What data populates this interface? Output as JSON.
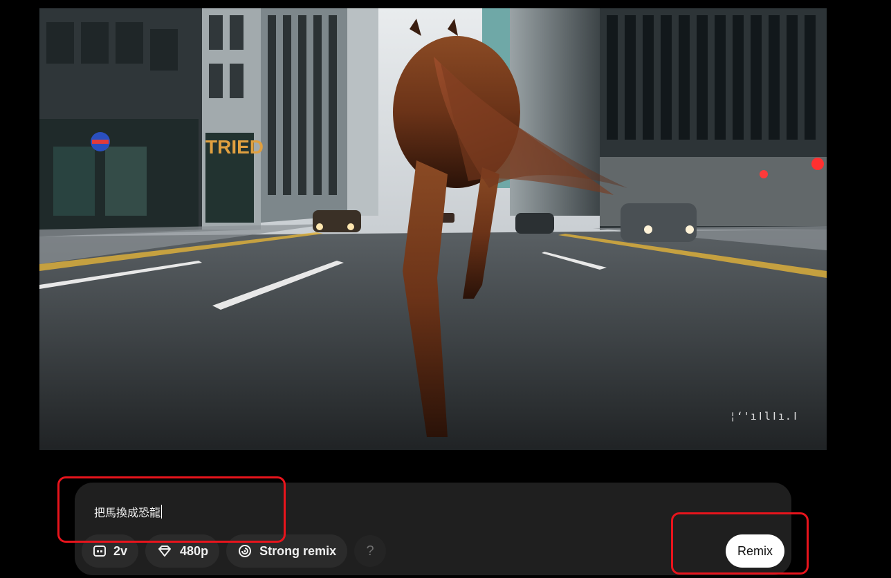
{
  "video": {
    "watermark": "¦ʻ'ıǀlǀı.ǀ",
    "storefront_sign": "TRIED"
  },
  "composer": {
    "prompt_value": "把馬換成恐龍",
    "chips": {
      "variations_label": "2v",
      "resolution_label": "480p",
      "remix_strength_label": "Strong remix",
      "help_label": "?"
    },
    "remix_label": "Remix"
  },
  "colors": {
    "composer_bg": "#1f1f1f",
    "chip_bg": "#2b2b2b",
    "annotation": "#e8141c",
    "remix_bg": "#ffffff"
  }
}
